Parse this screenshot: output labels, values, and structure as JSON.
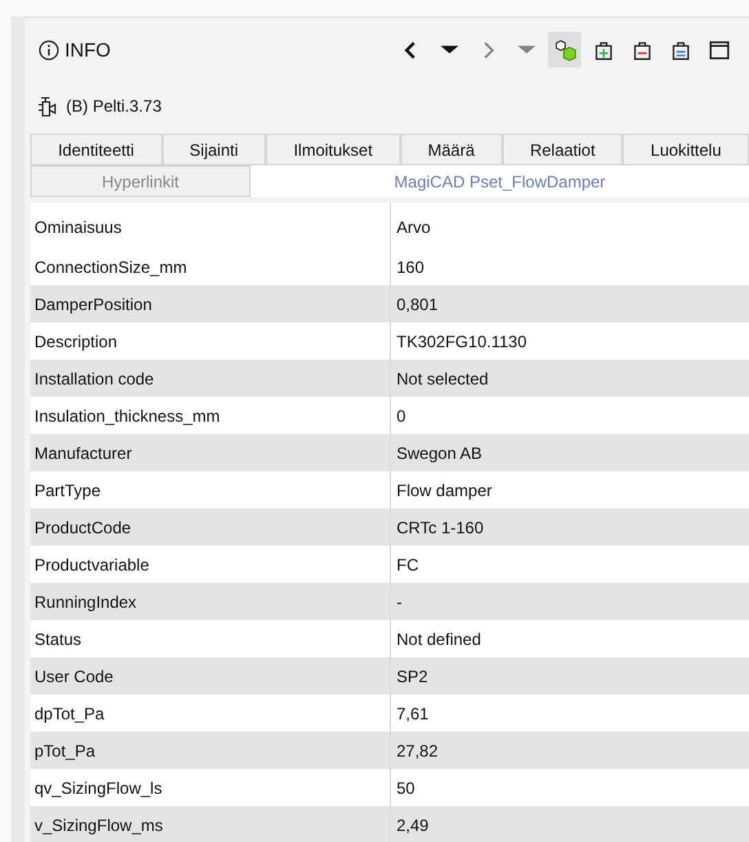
{
  "header": {
    "title": "INFO",
    "subtitle": "(B) Pelti.3.73"
  },
  "toolbar": [
    {
      "kind": "back",
      "disabled": false,
      "pressed": false
    },
    {
      "kind": "caret",
      "disabled": false,
      "pressed": false
    },
    {
      "kind": "forward",
      "disabled": true,
      "pressed": false
    },
    {
      "kind": "caret",
      "disabled": true,
      "pressed": false
    },
    {
      "kind": "objects",
      "disabled": false,
      "pressed": true
    },
    {
      "kind": "add",
      "disabled": false,
      "pressed": false
    },
    {
      "kind": "remove",
      "disabled": false,
      "pressed": false
    },
    {
      "kind": "equal",
      "disabled": false,
      "pressed": false
    },
    {
      "kind": "window",
      "disabled": false,
      "pressed": false
    }
  ],
  "tabs": [
    [
      {
        "label": "Identiteetti",
        "selected": false
      },
      {
        "label": "Sijainti",
        "selected": false
      },
      {
        "label": "Ilmoitukset",
        "selected": false
      },
      {
        "label": "Määrä",
        "selected": false
      },
      {
        "label": "Relaatiot",
        "selected": false
      },
      {
        "label": "Luokittelu",
        "selected": false
      }
    ],
    [
      {
        "label": "Hyperlinkit",
        "selected": false
      },
      {
        "label": "MagiCAD Pset_FlowDamper",
        "selected": true
      }
    ]
  ],
  "table": {
    "columns": [
      "Ominaisuus",
      "Arvo"
    ],
    "rows": [
      [
        "ConnectionSize_mm",
        "160"
      ],
      [
        "DamperPosition",
        "0,801"
      ],
      [
        "Description",
        "TK302FG10.1130"
      ],
      [
        "Installation code",
        "Not selected"
      ],
      [
        "Insulation_thickness_mm",
        "0"
      ],
      [
        "Manufacturer",
        "Swegon AB"
      ],
      [
        "PartType",
        "Flow damper"
      ],
      [
        "ProductCode",
        "CRTc 1-160"
      ],
      [
        "Productvariable",
        "FC"
      ],
      [
        "RunningIndex",
        "-"
      ],
      [
        "Status",
        "Not defined"
      ],
      [
        "User Code",
        "SP2"
      ],
      [
        "dpTot_Pa",
        "7,61"
      ],
      [
        "pTot_Pa",
        "27,82"
      ],
      [
        "qv_SizingFlow_ls",
        "50"
      ],
      [
        "v_SizingFlow_ms",
        "2,49"
      ]
    ]
  }
}
